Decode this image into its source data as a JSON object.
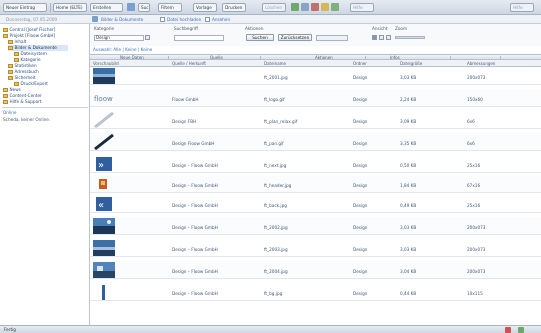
{
  "toolbar": {
    "new_label": "Neuer Eintrag",
    "home_label": "Home (ELTE)",
    "edit_label": "Erstellen",
    "search_label": "Suchen",
    "filter_label": "Filtern",
    "preview_label": "Vorlage",
    "print_label": "Drucken",
    "right_label": "Löschen",
    "far_right_label": "Hilfe"
  },
  "subbar": {
    "date": "Donnerstag, 07.05.2009",
    "link1": "Bilder & Dokumente",
    "link2": "Datei hochladen",
    "link3": "Ansehen"
  },
  "sidebar": {
    "items": [
      {
        "label": "Central [Josef Fischer]"
      },
      {
        "label": "Projekt [Floow GmbH]"
      },
      {
        "label": "Inhalt"
      },
      {
        "label": "Bilder & Dokumente"
      },
      {
        "label": "Dateisystem"
      },
      {
        "label": "Kategorie"
      },
      {
        "label": "Statistiken"
      },
      {
        "label": "Adressbuch"
      },
      {
        "label": "Sicherheit"
      },
      {
        "label": "Druck/Export"
      },
      {
        "label": "News"
      },
      {
        "label": "Content-Center"
      },
      {
        "label": "Hilfe & Support"
      }
    ],
    "online_title": "Online",
    "online_text": "Scheda, keiner Online."
  },
  "filter": {
    "kategorie_label": "Kategorie",
    "kategorie_value": "Design",
    "suchbegriff_label": "Suchbegriff",
    "aktionen_label": "Aktionen",
    "search_btn": "Suchen",
    "reset_btn": "Zurücksetzen",
    "ansicht_label": "Ansicht",
    "zoom_label": "Zoom",
    "selection_text": "Auswahl: Alle | Keine | Keine"
  },
  "table": {
    "group_headers": [
      "Neue Daten",
      "Quelle",
      "Aktionen",
      "Infos"
    ],
    "headers": [
      "Vorschaubild",
      "Quelle / Herkunft",
      "Dateiname",
      "Ordner",
      "Dateigröße",
      "Abmessungen"
    ],
    "rows": [
      {
        "quelle": "",
        "name": "ft_2001.jpg",
        "ordner": "Design",
        "groesse": "3,03 KB",
        "abm": "200x073"
      },
      {
        "quelle": "Floow GmbH",
        "name": "ft_logo.gif",
        "ordner": "Design",
        "groesse": "2,24 KB",
        "abm": "150x60"
      },
      {
        "quelle": "Design FBH",
        "name": "ft_plan_relax.gif",
        "ordner": "Design",
        "groesse": "3,09 KB",
        "abm": "6x6"
      },
      {
        "quelle": "Design Floow GmbH",
        "name": "ft_pan.gif",
        "ordner": "Design",
        "groesse": "3,35 KB",
        "abm": "6x6"
      },
      {
        "quelle": "Design – Floow GmbH",
        "name": "ft_next.jpg",
        "ordner": "Design",
        "groesse": "0,50 KB",
        "abm": "25x16"
      },
      {
        "quelle": "Design – Floow GmbH",
        "name": "ft_header.jpg",
        "ordner": "Design",
        "groesse": "1,84 KB",
        "abm": "67x16"
      },
      {
        "quelle": "Design – Floow GmbH",
        "name": "ft_back.jpg",
        "ordner": "Design",
        "groesse": "0,49 KB",
        "abm": "25x16"
      },
      {
        "quelle": "Design – Floow GmbH",
        "name": "ft_2002.jpg",
        "ordner": "Design",
        "groesse": "3,03 KB",
        "abm": "200x073"
      },
      {
        "quelle": "Design – Floow GmbH",
        "name": "ft_2003.jpg",
        "ordner": "Design",
        "groesse": "3,03 KB",
        "abm": "200x073"
      },
      {
        "quelle": "Design – Floow GmbH",
        "name": "ft_2004.jpg",
        "ordner": "Design",
        "groesse": "3,04 KB",
        "abm": "200x073"
      },
      {
        "quelle": "Design – Floow GmbH",
        "name": "ft_bg.jpg",
        "ordner": "Design",
        "groesse": "0,44 KB",
        "abm": "10x115"
      }
    ]
  },
  "status": {
    "text": "Fertig"
  },
  "colors": {
    "accent": "#3b6db8",
    "folder": "#e9c25a"
  }
}
